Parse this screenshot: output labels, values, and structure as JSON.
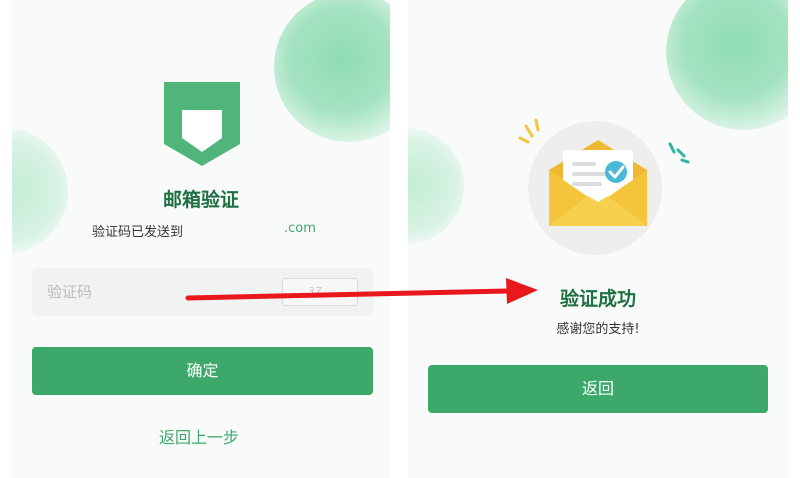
{
  "left": {
    "title": "邮箱验证",
    "subtitle_prefix": "验证码已发送到",
    "email_domain": ".com",
    "code_input": {
      "placeholder": "验证码",
      "captcha_text": "37..."
    },
    "confirm_label": "确定",
    "back_link": "返回上一步",
    "icon": "shield-icon"
  },
  "right": {
    "title": "验证成功",
    "caption": "感谢您的支持!",
    "return_label": "返回",
    "icon": "envelope-check-icon"
  },
  "arrow": {
    "color": "#e8181c"
  },
  "colors": {
    "primary_green": "#3ca96b",
    "title_green": "#1f6f43",
    "blob_green": "#a5e3c2",
    "arrow_red": "#e8181c",
    "envelope_yellow": "#f4c43a",
    "check_blue": "#4bb8d8"
  }
}
